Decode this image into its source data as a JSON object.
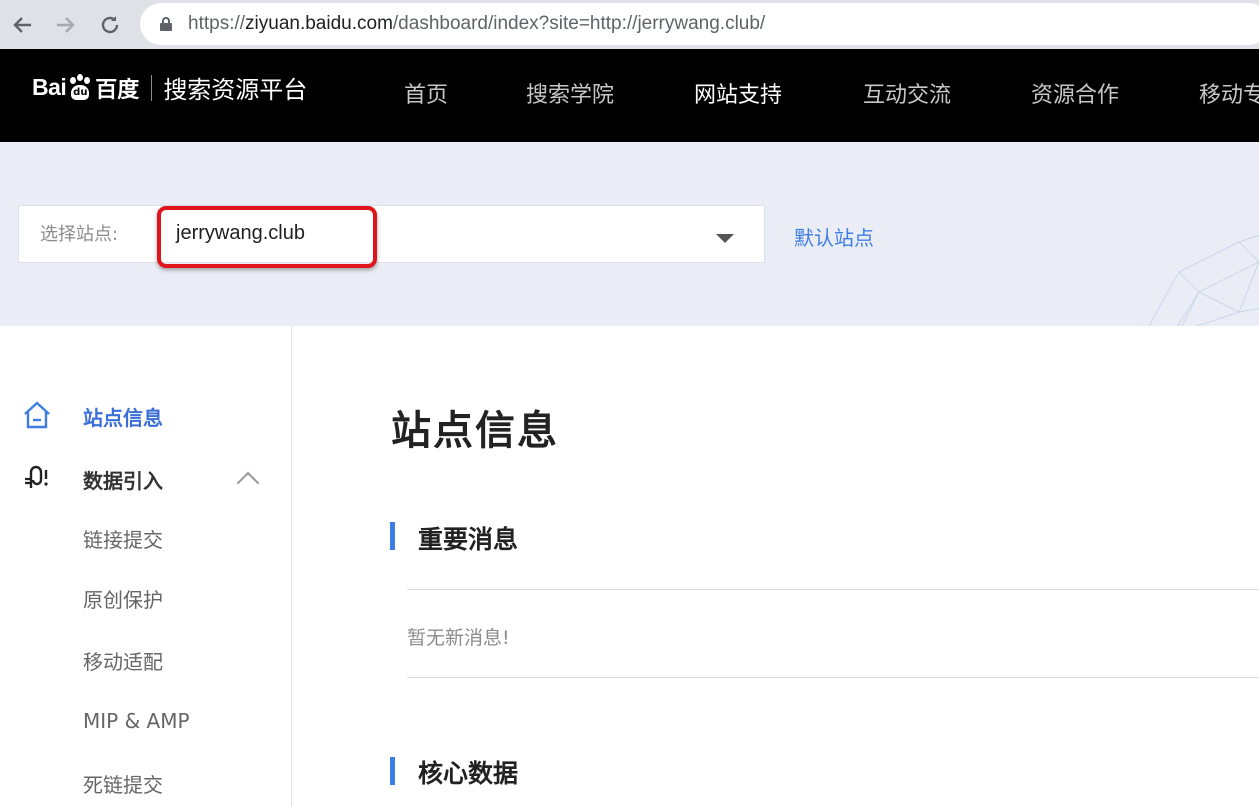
{
  "browser": {
    "url_prefix": "https://",
    "url_host": "ziyuan.baidu.com",
    "url_rest": "/dashboard/index?site=http://jerrywang.club/",
    "back_icon": "arrow-left-icon",
    "forward_icon": "arrow-right-icon",
    "reload_icon": "reload-icon",
    "lock_icon": "lock-icon"
  },
  "header": {
    "logo_latin": "Bai",
    "logo_du": "du",
    "logo_cn": "百度",
    "platform_name": "搜索资源平台",
    "menu": [
      {
        "label": "首页"
      },
      {
        "label": "搜索学院"
      },
      {
        "label": "网站支持"
      },
      {
        "label": "互动交流"
      },
      {
        "label": "资源合作"
      },
      {
        "label": "移动专"
      }
    ],
    "active_index": 2
  },
  "site_selector": {
    "label": "选择站点:",
    "value": "jerrywang.club",
    "default_link": "默认站点"
  },
  "sidebar": {
    "items": [
      {
        "label": "站点信息",
        "icon": "home-icon",
        "active": true
      },
      {
        "label": "数据引入",
        "icon": "data-import-icon",
        "expanded": true,
        "children": [
          "链接提交",
          "原创保护",
          "移动适配",
          "MIP & AMP",
          "死链提交"
        ]
      }
    ]
  },
  "main": {
    "title": "站点信息",
    "sections": [
      {
        "title": "重要消息",
        "empty_text": "暂无新消息!"
      },
      {
        "title": "核心数据"
      }
    ]
  },
  "colors": {
    "accent": "#3e7de6",
    "highlight_box": "#e0151b",
    "nav_bg": "#000000",
    "banner_bg": "#eaedf5"
  }
}
